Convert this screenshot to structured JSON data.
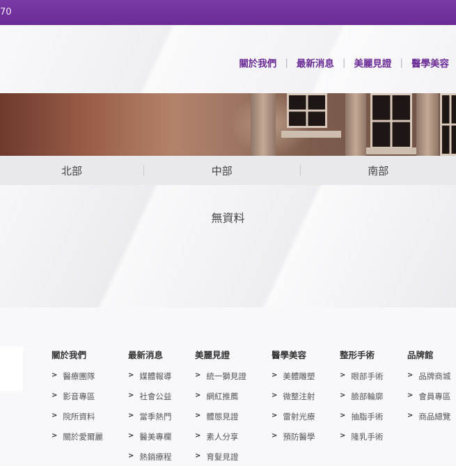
{
  "topbar": {
    "text": "70"
  },
  "topnav": {
    "items": [
      "關於我們",
      "最新消息",
      "美麗見證",
      "醫學美容"
    ]
  },
  "regions": [
    "北部",
    "中部",
    "南部"
  ],
  "content": {
    "empty_message": "無資料"
  },
  "footer": {
    "columns": [
      {
        "title": "關於我們",
        "items": [
          "醫療團隊",
          "影音專區",
          "院所資料",
          "關於愛爾麗"
        ]
      },
      {
        "title": "最新消息",
        "items": [
          "媒體報導",
          "社會公益",
          "當季熱門",
          "醫美專欄",
          "熱銷療程"
        ]
      },
      {
        "title": "美麗見證",
        "items": [
          "統一獅見證",
          "網紅推薦",
          "體態見證",
          "素人分享",
          "育髮見證"
        ]
      },
      {
        "title": "醫學美容",
        "items": [
          "美體雕塑",
          "微整注射",
          "雷射光療",
          "預防醫學"
        ]
      },
      {
        "title": "整形手術",
        "items": [
          "眼部手術",
          "臉部輪廓",
          "抽脂手術",
          "隆乳手術"
        ]
      },
      {
        "title": "品牌館",
        "items": [
          "品牌商城",
          "會員專區",
          "商品總覽"
        ]
      }
    ]
  },
  "colors": {
    "brand_purple": "#6a2b95",
    "topbar_purple": "#7b3aa5"
  }
}
